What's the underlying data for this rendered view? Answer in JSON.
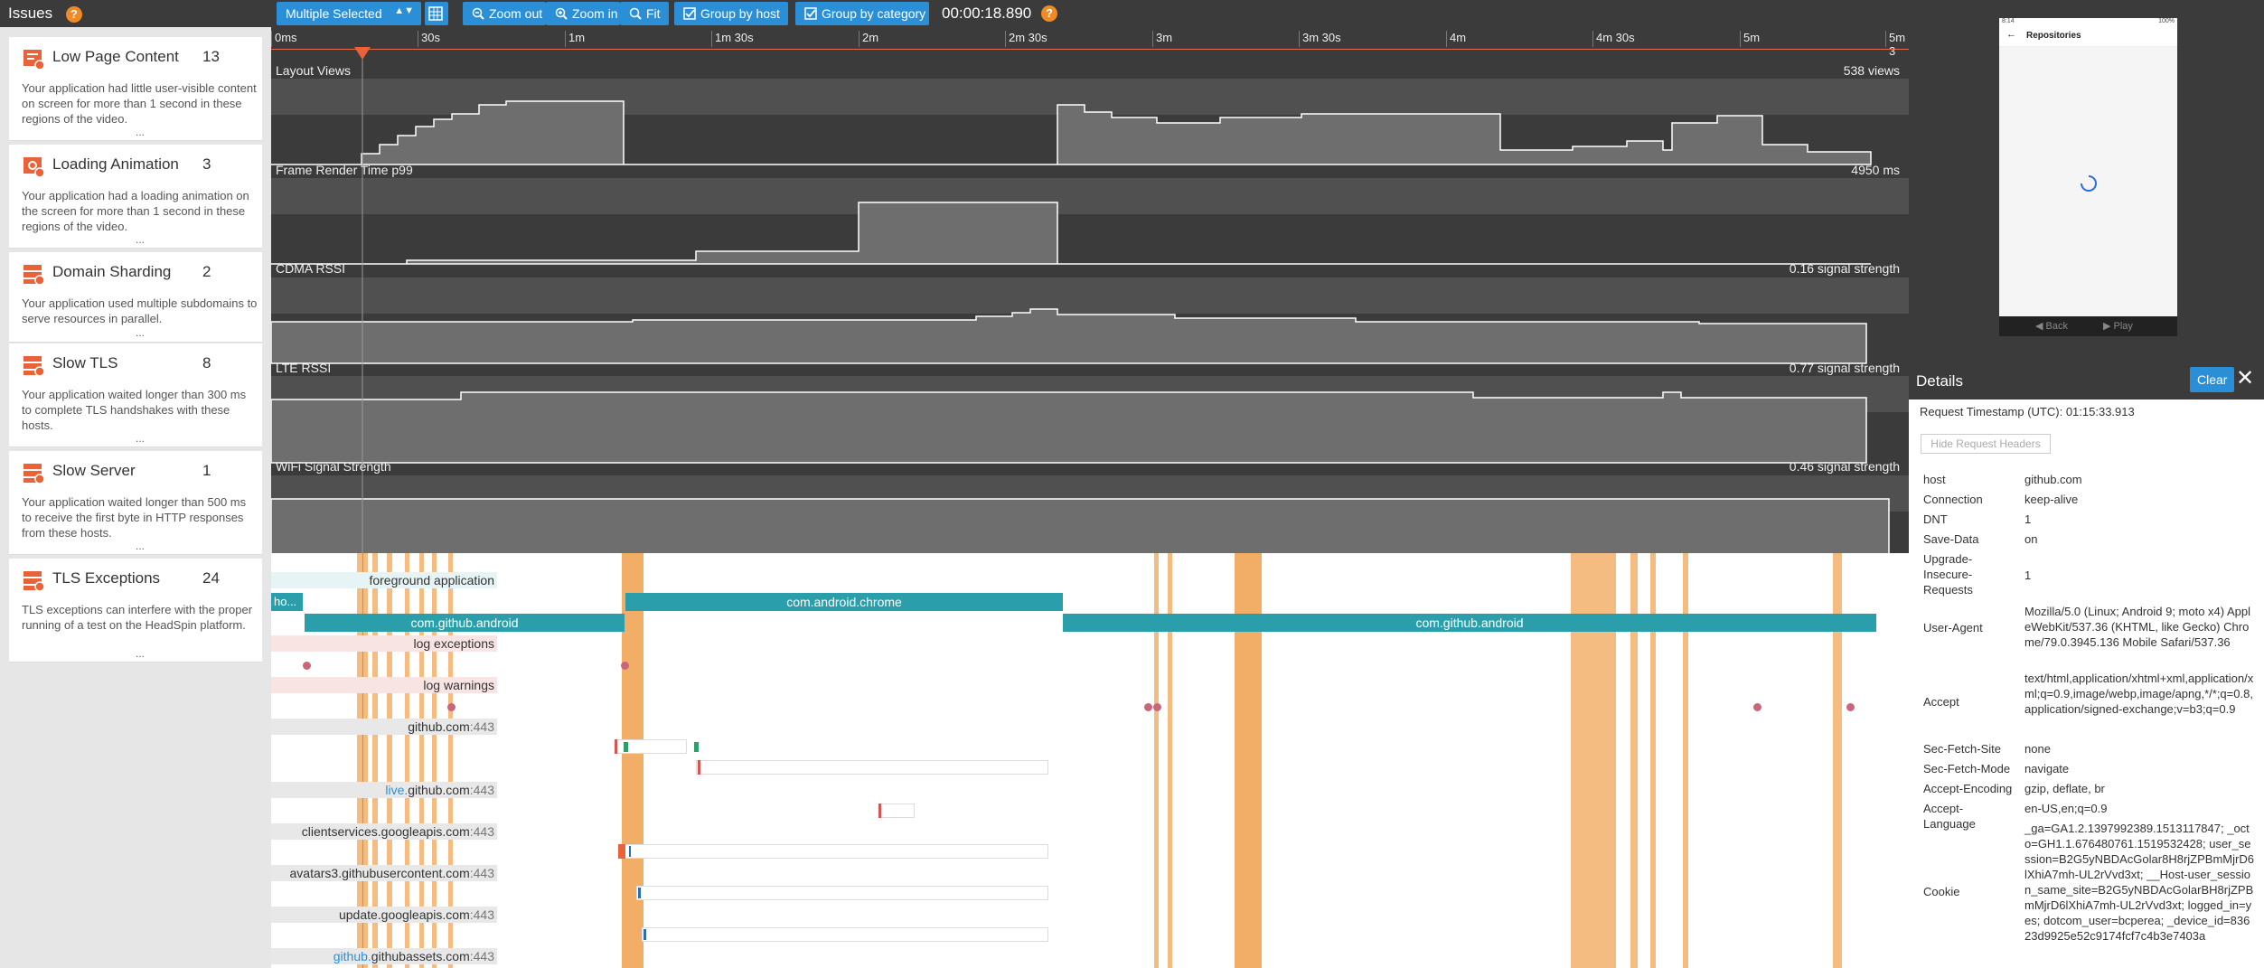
{
  "issues": {
    "title": "Issues",
    "help": "?",
    "items": [
      {
        "title": "Low Page Content",
        "count": "13",
        "desc": "Your application had little user-visible content on screen for more than 1 second in these regions of the video.",
        "more": "..."
      },
      {
        "title": "Loading Animation",
        "count": "3",
        "desc": "Your application had a loading animation on the screen for more than 1 second in these regions of the video.",
        "more": "..."
      },
      {
        "title": "Domain Sharding",
        "count": "2",
        "desc": "Your application used multiple subdomains to serve resources in parallel.",
        "more": "..."
      },
      {
        "title": "Slow TLS",
        "count": "8",
        "desc": "Your application waited longer than 300 ms to complete TLS handshakes with these hosts.",
        "more": "..."
      },
      {
        "title": "Slow Server",
        "count": "1",
        "desc": "Your application waited longer than 500 ms to receive the first byte in HTTP responses from these hosts.",
        "more": "..."
      },
      {
        "title": "TLS Exceptions",
        "count": "24",
        "desc": "TLS exceptions can interfere with the proper running of a test on the HeadSpin platform.",
        "more": "..."
      }
    ]
  },
  "toolbar": {
    "select_label": "Multiple Selected",
    "zoom_out": "Zoom out",
    "zoom_in": "Zoom in",
    "fit": "Fit",
    "group_host": "Group by host",
    "group_category": "Group by category",
    "time": "00:00:18.890",
    "help": "?"
  },
  "timeline": {
    "ticks": [
      "0ms",
      "30s",
      "1m",
      "1m 30s",
      "2m",
      "2m 30s",
      "3m",
      "3m 30s",
      "4m",
      "4m 30s",
      "5m",
      "5m 3"
    ],
    "tracks": [
      {
        "label": "Layout Views",
        "value": "538 views"
      },
      {
        "label": "Frame Render Time p99",
        "value": "4950 ms"
      },
      {
        "label": "CDMA RSSI",
        "value": "0.16 signal strength"
      },
      {
        "label": "LTE RSSI",
        "value": "0.77 signal strength"
      },
      {
        "label": "WiFi Signal Strength",
        "value": "0.46 signal strength"
      }
    ]
  },
  "lower": {
    "foreground": "foreground application",
    "app_ho": "ho...",
    "app_chrome": "com.android.chrome",
    "app_github1": "com.github.android",
    "app_github2": "com.github.android",
    "log_exceptions": "log exceptions",
    "log_warnings": "log warnings",
    "hosts": [
      {
        "sub": "",
        "host": "github.com",
        "port": ":443"
      },
      {
        "sub": "live.",
        "host": "github.com",
        "port": ":443"
      },
      {
        "sub": "",
        "host": "clientservices.googleapis.com",
        "port": ":443"
      },
      {
        "sub": "",
        "host": "avatars3.githubusercontent.com",
        "port": ":443"
      },
      {
        "sub": "",
        "host": "update.googleapis.com",
        "port": ":443"
      },
      {
        "sub": "github.",
        "host": "githubassets.com",
        "port": ":443"
      }
    ]
  },
  "phone": {
    "status_left": "8:14",
    "status_right": "100%",
    "title": "Repositories",
    "back": "Back",
    "play": "Play"
  },
  "details": {
    "title": "Details",
    "clear": "Clear",
    "timestamp_label": "Request Timestamp (UTC):",
    "timestamp_value": "01:15:33.913",
    "hide_headers": "Hide Request Headers",
    "headers": [
      {
        "k": "host",
        "v": "github.com"
      },
      {
        "k": "Connection",
        "v": "keep-alive"
      },
      {
        "k": "DNT",
        "v": "1"
      },
      {
        "k": "Save-Data",
        "v": "on"
      },
      {
        "k": "Upgrade-Insecure-Requests",
        "v": "1"
      },
      {
        "k": "User-Agent",
        "v": "Mozilla/5.0 (Linux; Android 9; moto x4) AppleWebKit/537.36 (KHTML, like Gecko) Chrome/79.0.3945.136 Mobile Safari/537.36"
      },
      {
        "k": "Accept",
        "v": "text/html,application/xhtml+xml,application/xml;q=0.9,image/webp,image/apng,*/*;q=0.8,application/signed-exchange;v=b3;q=0.9"
      },
      {
        "k": "Sec-Fetch-Site",
        "v": "none"
      },
      {
        "k": "Sec-Fetch-Mode",
        "v": "navigate"
      },
      {
        "k": "Accept-Encoding",
        "v": "gzip, deflate, br"
      },
      {
        "k": "Accept-Language",
        "v": "en-US,en;q=0.9"
      },
      {
        "k": "Cookie",
        "v": "_ga=GA1.2.1397992389.1513117847; _octo=GH1.1.676480761.1519532428; user_session=B2G5yNBDAcGolar8H8rjZPBmMjrD6lXhiA7mh-UL2rVvd3xt; __Host-user_session_same_site=B2G5yNBDAcGolarBH8rjZPBmMjrD6lXhiA7mh-UL2rVvd3xt; logged_in=yes; dotcom_user=bcperea; _device_id=83623d9925e52c9174fcf7c4b3e7403a"
      }
    ]
  },
  "colors": {
    "accent": "#2a8fd6",
    "orange": "#f0a04b",
    "teal": "#2a9fab",
    "dark": "#3b3b3b"
  }
}
